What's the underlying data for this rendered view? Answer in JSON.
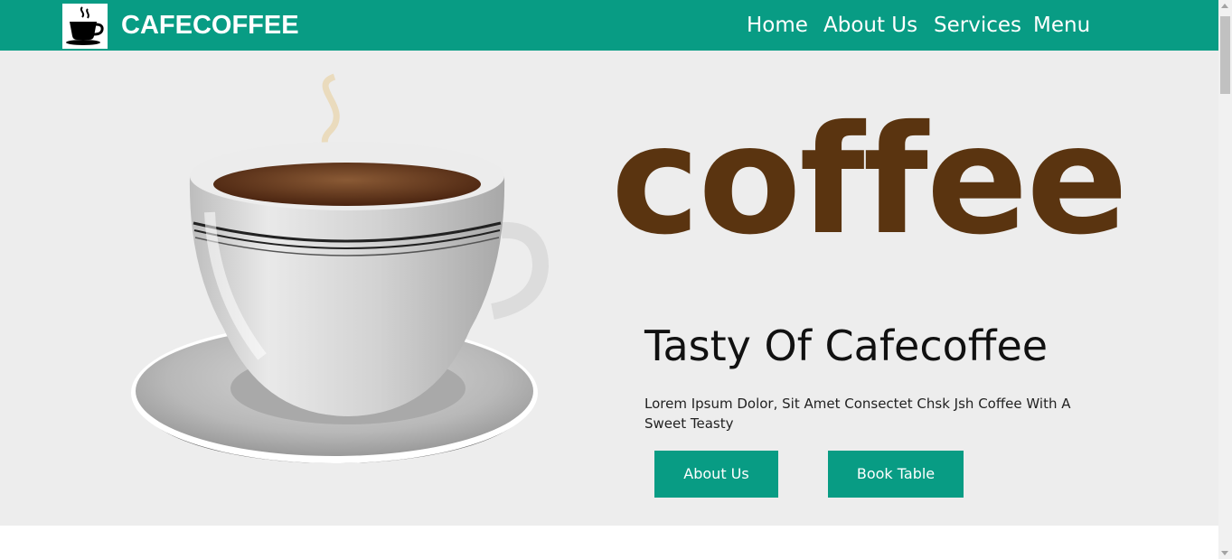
{
  "brand": {
    "name": "CAFECOFFEE",
    "logo": "coffee-cup-icon"
  },
  "nav": {
    "items": [
      {
        "label": "Home"
      },
      {
        "label": "About Us"
      },
      {
        "label": "Services"
      },
      {
        "label": "Menu"
      }
    ]
  },
  "hero": {
    "big_word": "coffee",
    "tagline": "Tasty Of Cafecoffee",
    "description": "Lorem Ipsum Dolor, Sit Amet Consectet Chsk Jsh Coffee With A Sweet Teasty",
    "buttons": {
      "about": "About Us",
      "book": "Book Table"
    }
  },
  "colors": {
    "accent": "#089c84",
    "hero_bg": "#ededed",
    "coffee_brown": "#5a3410"
  }
}
